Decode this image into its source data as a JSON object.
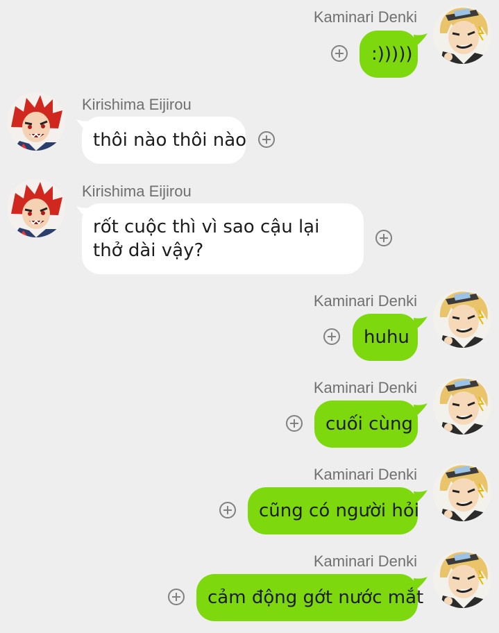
{
  "contacts": {
    "right": {
      "name": "Kaminari Denki",
      "avatar_icon": "kaminari-avatar-icon"
    },
    "left": {
      "name": "Kirishima Eijirou",
      "avatar_icon": "kirishima-avatar-icon"
    }
  },
  "colors": {
    "background": "#eeeeee",
    "outgoing_bubble": "#7ed80e",
    "incoming_bubble": "#ffffff",
    "name_text": "#6f6f6f"
  },
  "messages": [
    {
      "sender": "Kaminari Denki",
      "side": "right",
      "text": ":)))))"
    },
    {
      "sender": "Kirishima Eijirou",
      "side": "left",
      "text": "thôi nào thôi nào"
    },
    {
      "sender": "Kirishima Eijirou",
      "side": "left",
      "text": "rốt cuộc thì vì sao cậu lại thở dài vậy?"
    },
    {
      "sender": "Kaminari Denki",
      "side": "right",
      "text": "huhu"
    },
    {
      "sender": "Kaminari Denki",
      "side": "right",
      "text": "cuối cùng"
    },
    {
      "sender": "Kaminari Denki",
      "side": "right",
      "text": "cũng có người hỏi"
    },
    {
      "sender": "Kaminari Denki",
      "side": "right",
      "text": "cảm động gớt nước mắt"
    }
  ]
}
